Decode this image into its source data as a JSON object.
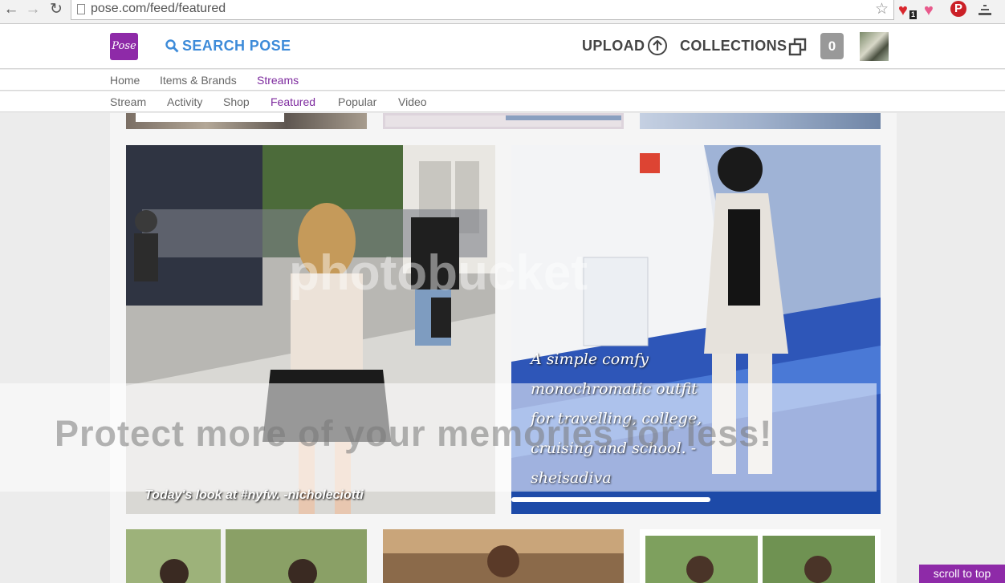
{
  "browser": {
    "url": "pose.com/feed/featured",
    "badge_count": "1"
  },
  "header": {
    "logo_text": "Pose",
    "search_label": "SEARCH POSE",
    "upload_label": "UPLOAD",
    "collections_label": "COLLECTIONS",
    "collections_count": "0"
  },
  "nav_primary": {
    "items": [
      "Home",
      "Items & Brands",
      "Streams"
    ],
    "active": "Streams"
  },
  "nav_secondary": {
    "items": [
      "Stream",
      "Activity",
      "Shop",
      "Featured",
      "Popular",
      "Video"
    ],
    "active": "Featured"
  },
  "posts": {
    "post1_caption": "Today's look at #nyfw. -nicholeciotti",
    "post2_caption": "A simple comfy monochromatic outfit for travelling, college, cruising and school. - sheisadiva"
  },
  "watermark": {
    "text": "Protect more of your memories for less!",
    "logo": "photobucket"
  },
  "scroll_top_label": "scroll to top",
  "colors": {
    "brand_purple": "#8e2aa8",
    "link_blue": "#3d8bd9",
    "active_nav": "#7d2a9e"
  }
}
